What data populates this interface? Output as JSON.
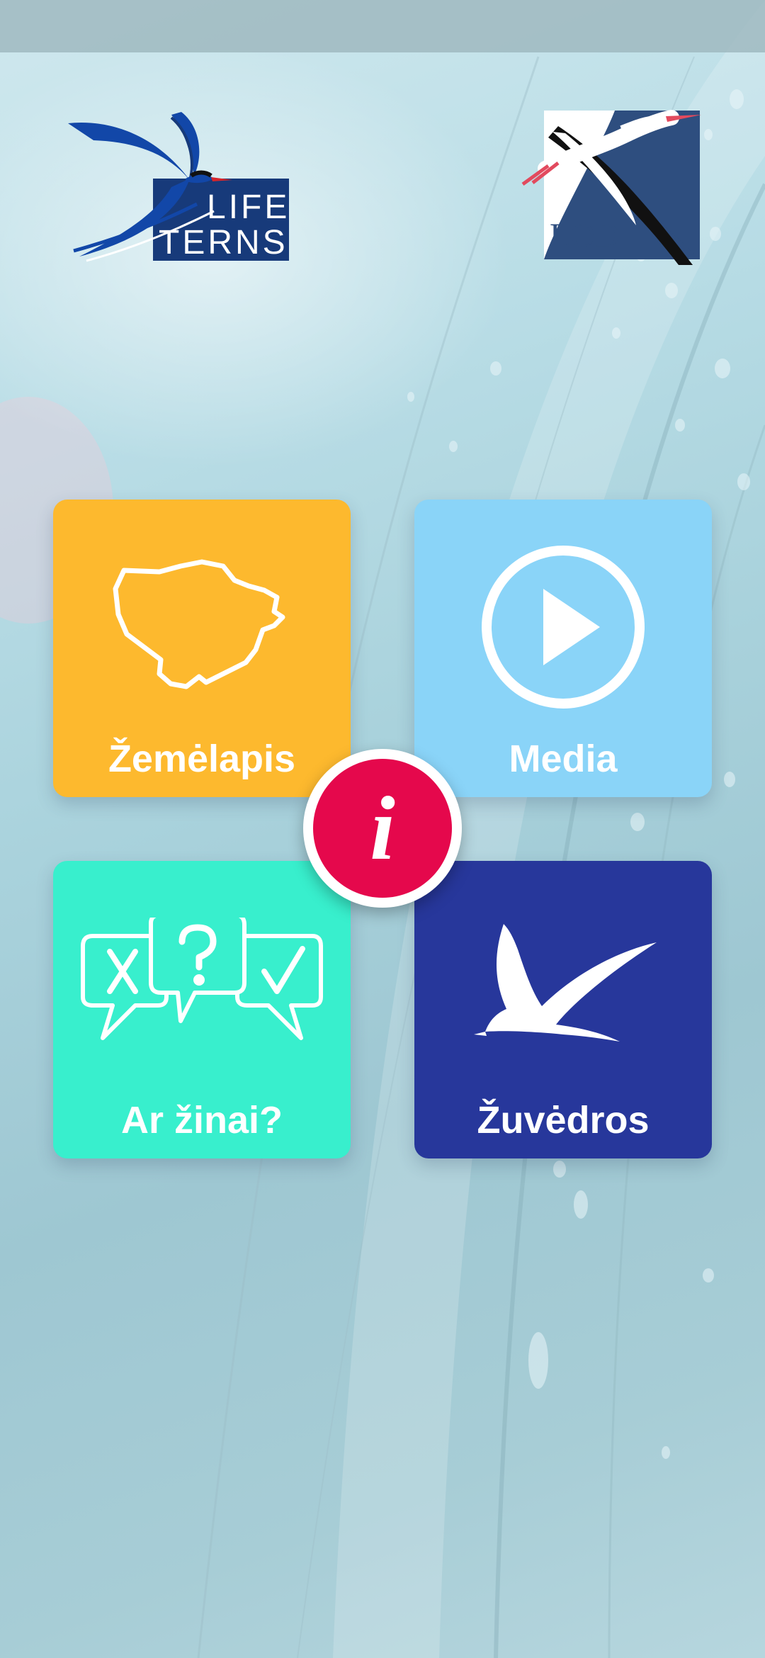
{
  "colors": {
    "map_tile": "#FDB92E",
    "media_tile": "#8AD4F8",
    "quiz_tile": "#38EFCD",
    "gulls_tile": "#27379B",
    "info_button": "#E5084C",
    "life_logo_blue": "#1247A8",
    "life_logo_navy": "#173A7A",
    "lod_logo_navy": "#2E4E7F"
  },
  "logos": {
    "life_terns": {
      "icon": "tern-bird-logo",
      "line1": "LIFE",
      "line2": "TERNS"
    },
    "lod": {
      "icon": "stork-logo",
      "text": "LOD"
    }
  },
  "tiles": [
    {
      "id": "map",
      "label": "Žemėlapis",
      "icon": "lithuania-map-icon"
    },
    {
      "id": "media",
      "label": "Media",
      "icon": "play-circle-icon"
    },
    {
      "id": "quiz",
      "label": "Ar žinai?",
      "icon": "quiz-speech-bubbles-icon"
    },
    {
      "id": "gulls",
      "label": "Žuvėdros",
      "icon": "tern-silhouette-icon"
    }
  ],
  "info_button": {
    "icon": "info-icon",
    "glyph": "i"
  }
}
